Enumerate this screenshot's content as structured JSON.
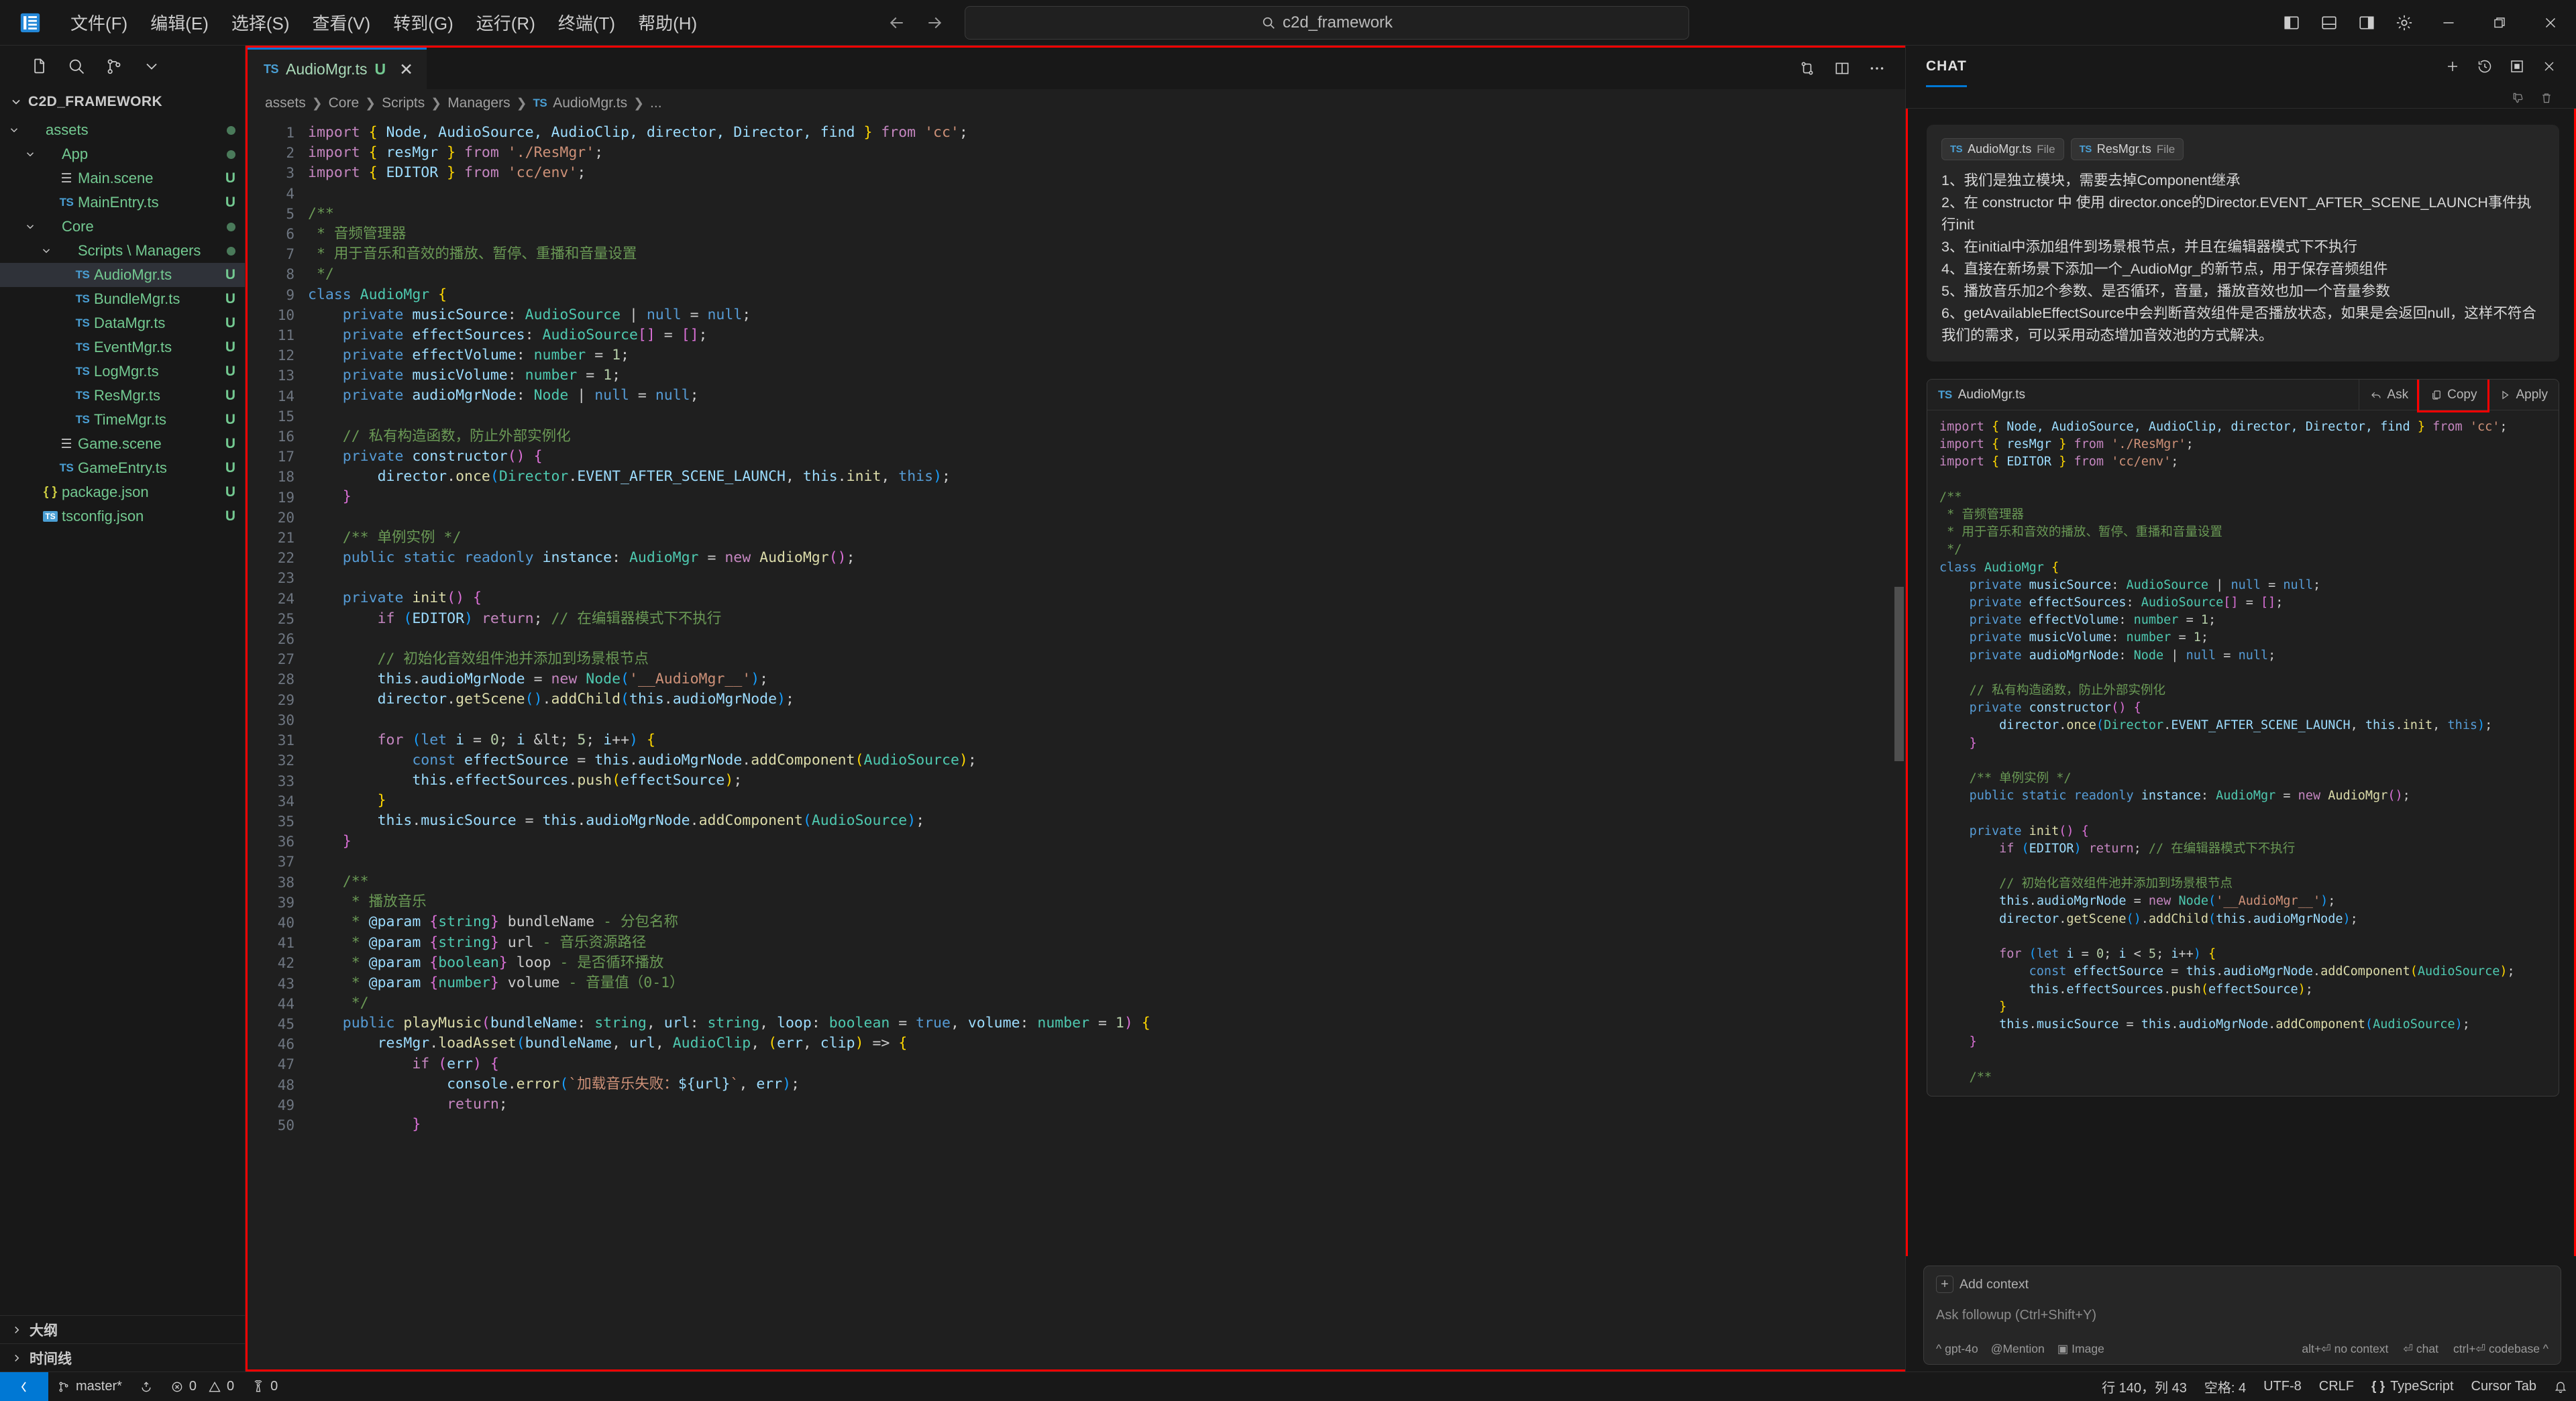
{
  "titlebar": {
    "logo_icon": "vscode-logo-icon",
    "menu": [
      {
        "label": "文件(F)",
        "name": "menu-file"
      },
      {
        "label": "编辑(E)",
        "name": "menu-edit"
      },
      {
        "label": "选择(S)",
        "name": "menu-selection"
      },
      {
        "label": "查看(V)",
        "name": "menu-view"
      },
      {
        "label": "转到(G)",
        "name": "menu-go"
      },
      {
        "label": "运行(R)",
        "name": "menu-run"
      },
      {
        "label": "终端(T)",
        "name": "menu-terminal"
      },
      {
        "label": "帮助(H)",
        "name": "menu-help"
      }
    ],
    "back_icon": "arrow-left-icon",
    "forward_icon": "arrow-right-icon",
    "search": {
      "value": "c2d_framework",
      "icon": "search-icon"
    },
    "layout_icons": [
      "toggle-primary-sidebar-icon",
      "toggle-panel-icon",
      "toggle-secondary-sidebar-icon",
      "gear-icon"
    ],
    "window_buttons": [
      "minimize-icon",
      "restore-icon",
      "close-icon"
    ]
  },
  "sidebar": {
    "toolbar_icons": [
      "new-file-icon",
      "search-icon",
      "source-control-icon",
      "chevron-down-icon"
    ],
    "root_label": "C2D_FRAMEWORK",
    "tree": [
      {
        "label": "assets",
        "indent": 1,
        "icon": "folder",
        "chev": "down",
        "status": "dot",
        "name": "tree-item-assets"
      },
      {
        "label": "App",
        "indent": 2,
        "icon": "folder",
        "chev": "down",
        "status": "dot",
        "name": "tree-item-app"
      },
      {
        "label": "Main.scene",
        "indent": 3,
        "icon": "scene",
        "chev": "",
        "status": "U",
        "name": "tree-item-main-scene"
      },
      {
        "label": "MainEntry.ts",
        "indent": 3,
        "icon": "ts",
        "chev": "",
        "status": "U",
        "name": "tree-item-mainentry-ts"
      },
      {
        "label": "Core",
        "indent": 2,
        "icon": "folder",
        "chev": "down",
        "status": "dot",
        "name": "tree-item-core"
      },
      {
        "label": "Scripts \\ Managers",
        "indent": 3,
        "icon": "folder",
        "chev": "down",
        "status": "dot",
        "name": "tree-item-scripts-managers"
      },
      {
        "label": "AudioMgr.ts",
        "indent": 4,
        "icon": "ts",
        "chev": "",
        "status": "U",
        "selected": true,
        "name": "tree-item-audiomgr-ts"
      },
      {
        "label": "BundleMgr.ts",
        "indent": 4,
        "icon": "ts",
        "chev": "",
        "status": "U",
        "name": "tree-item-bundlemgr-ts"
      },
      {
        "label": "DataMgr.ts",
        "indent": 4,
        "icon": "ts",
        "chev": "",
        "status": "U",
        "name": "tree-item-datamgr-ts"
      },
      {
        "label": "EventMgr.ts",
        "indent": 4,
        "icon": "ts",
        "chev": "",
        "status": "U",
        "name": "tree-item-eventmgr-ts"
      },
      {
        "label": "LogMgr.ts",
        "indent": 4,
        "icon": "ts",
        "chev": "",
        "status": "U",
        "name": "tree-item-logmgr-ts"
      },
      {
        "label": "ResMgr.ts",
        "indent": 4,
        "icon": "ts",
        "chev": "",
        "status": "U",
        "name": "tree-item-resmgr-ts"
      },
      {
        "label": "TimeMgr.ts",
        "indent": 4,
        "icon": "ts",
        "chev": "",
        "status": "U",
        "name": "tree-item-timemgr-ts"
      },
      {
        "label": "Game.scene",
        "indent": 3,
        "icon": "scene",
        "chev": "",
        "status": "U",
        "name": "tree-item-game-scene"
      },
      {
        "label": "GameEntry.ts",
        "indent": 3,
        "icon": "ts",
        "chev": "",
        "status": "U",
        "name": "tree-item-gameentry-ts"
      },
      {
        "label": "package.json",
        "indent": 2,
        "icon": "json",
        "chev": "",
        "status": "U",
        "name": "tree-item-package-json"
      },
      {
        "label": "tsconfig.json",
        "indent": 2,
        "icon": "tsconf",
        "chev": "",
        "status": "U",
        "name": "tree-item-tsconfig-json"
      }
    ],
    "sections": [
      {
        "label": "大纲",
        "name": "sidebar-section-outline"
      },
      {
        "label": "时间线",
        "name": "sidebar-section-timeline"
      }
    ]
  },
  "editor": {
    "tab": {
      "filename": "AudioMgr.ts",
      "badge": "U",
      "close": "✕",
      "icon": "typescript-file-icon"
    },
    "tab_actions": [
      "split-diff-icon",
      "split-editor-icon",
      "more-actions-icon"
    ],
    "breadcrumb": [
      "assets",
      "Core",
      "Scripts",
      "Managers",
      "AudioMgr.ts",
      "..."
    ],
    "first_line": 1,
    "last_line": 50
  },
  "chat": {
    "title": "CHAT",
    "header_icons": [
      "new-chat-icon",
      "history-icon",
      "maximize-chat-icon",
      "close-icon"
    ],
    "subbar_icons": [
      "thumbs-down-icon",
      "trash-icon"
    ],
    "message": {
      "chips": [
        {
          "name": "AudioMgr.ts",
          "kind": "File"
        },
        {
          "name": "ResMgr.ts",
          "kind": "File"
        }
      ],
      "lines": [
        "1、我们是独立模块，需要去掉Component继承",
        "2、在 constructor 中 使用 director.once的Director.EVENT_AFTER_SCENE_LAUNCH事件执行init",
        "3、在initial中添加组件到场景根节点，并且在编辑器模式下不执行",
        "4、直接在新场景下添加一个_AudioMgr_的新节点，用于保存音频组件",
        "5、播放音乐加2个参数、是否循环，音量，播放音效也加一个音量参数",
        "6、getAvailableEffectSource中会判断音效组件是否播放状态，如果是会返回null，这样不符合我们的需求，可以采用动态增加音效池的方式解决。"
      ]
    },
    "codeblock": {
      "filename": "AudioMgr.ts",
      "icon": "typescript-file-icon",
      "actions": [
        {
          "label": "Ask",
          "icon": "ask-icon",
          "name": "codeblock-ask-button"
        },
        {
          "label": "Copy",
          "icon": "copy-icon",
          "name": "codeblock-copy-button",
          "highlighted": true
        },
        {
          "label": "Apply",
          "icon": "apply-icon",
          "name": "codeblock-apply-button"
        }
      ]
    },
    "input": {
      "add_context_label": "Add context",
      "add_context_icon": "plus-icon",
      "placeholder": "Ask followup (Ctrl+Shift+Y)",
      "model": "gpt-4o",
      "model_caret": "^",
      "mention_label": "Mention",
      "mention_icon": "at-icon",
      "image_label": "Image",
      "image_icon": "image-icon",
      "hints": [
        "alt+⏎ no context",
        "⏎ chat",
        "ctrl+⏎ codebase ^"
      ]
    }
  },
  "statusbar": {
    "remote_icon": "remote-window-icon",
    "left": [
      {
        "label": "master*",
        "icon": "source-control-icon",
        "name": "status-branch"
      },
      {
        "label": "",
        "icon": "sync-icon",
        "name": "status-sync"
      },
      {
        "label": "0",
        "icon": "error-icon",
        "name": "status-errors"
      },
      {
        "label": "0",
        "icon": "warning-icon",
        "name": "status-warnings"
      },
      {
        "label": "0",
        "icon": "radio-tower-icon",
        "name": "status-ports"
      }
    ],
    "right": [
      {
        "label": "行 140，列 43",
        "name": "status-cursor-position"
      },
      {
        "label": "空格: 4",
        "name": "status-indentation"
      },
      {
        "label": "UTF-8",
        "name": "status-encoding"
      },
      {
        "label": "CRLF",
        "name": "status-eol"
      },
      {
        "label": "TypeScript",
        "icon": "json-braces-icon",
        "name": "status-language"
      },
      {
        "label": "Cursor Tab",
        "name": "status-cursor-tab"
      },
      {
        "label": "",
        "icon": "bell-icon",
        "name": "status-notifications"
      }
    ]
  },
  "colors": {
    "accent": "#0078d4",
    "highlight_red": "#ff0000",
    "green_file": "#73c991",
    "background": "#1f1f1f",
    "chrome": "#181818"
  }
}
